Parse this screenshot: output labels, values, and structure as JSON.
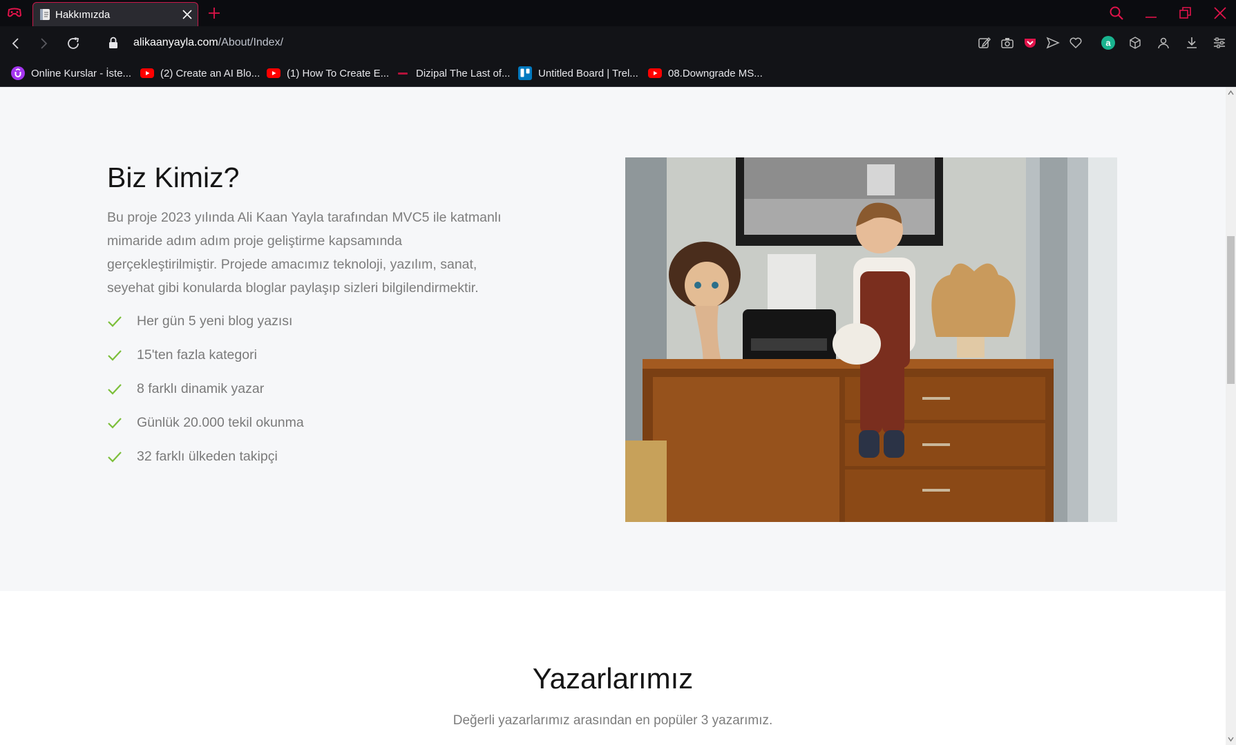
{
  "browser": {
    "tab": {
      "title": "Hakkımızda"
    },
    "address": {
      "host": "alikaanyayla.com",
      "path": "/About/Index/"
    },
    "bookmarks": [
      {
        "label": "Online Kurslar - İste...",
        "icon": "udemy-icon",
        "color": "#a435f0"
      },
      {
        "label": "(2) Create an AI Blo...",
        "icon": "youtube-icon",
        "color": "#ff0000"
      },
      {
        "label": "(1) How To Create E...",
        "icon": "youtube-icon",
        "color": "#ff0000"
      },
      {
        "label": "Dizipal The Last of...",
        "icon": "dizipal-icon",
        "color": "#b3123a"
      },
      {
        "label": "Untitled Board | Trel...",
        "icon": "trello-icon",
        "color": "#0079bf"
      },
      {
        "label": "08.Downgrade MS...",
        "icon": "youtube-icon",
        "color": "#ff0000"
      }
    ],
    "accent": "#e0134a"
  },
  "about": {
    "heading": "Biz Kimiz?",
    "paragraph": "Bu proje 2023 yılında Ali Kaan Yayla tarafından MVC5 ile katmanlı mimaride adım adım proje geliştirme kapsamında gerçekleştirilmiştir. Projede amacımız teknoloji, yazılım, sanat, seyehat gibi konularda bloglar paylaşıp sizleri bilgilendirmektir.",
    "features": [
      "Her gün 5 yeni blog yazısı",
      "15'ten fazla kategori",
      "8 farklı dinamik yazar",
      "Günlük 20.000 tekil okunma",
      "32 farklı ülkeden takipçi"
    ],
    "check_color": "#7cbf3a"
  },
  "authors": {
    "heading": "Yazarlarımız",
    "subtitle": "Değerli yazarlarımız arasından en popüler 3 yazarımız."
  }
}
